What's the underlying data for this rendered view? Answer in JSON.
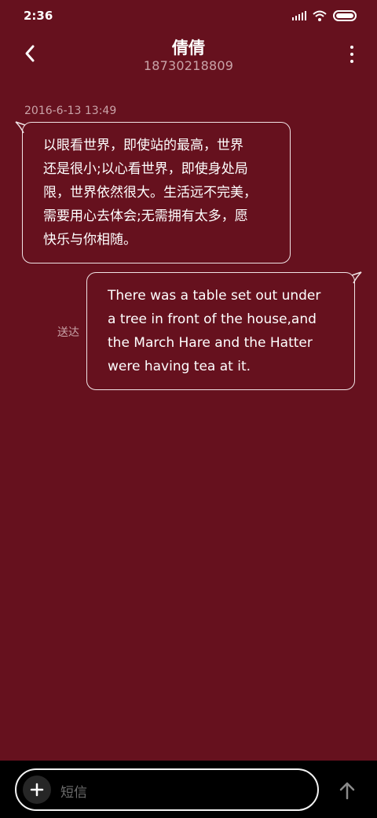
{
  "status_bar": {
    "time": "2:36",
    "icons": [
      "signal-icon",
      "wifi-icon",
      "battery-icon"
    ],
    "battery_level": 1.0
  },
  "header": {
    "contact_name": "倩倩",
    "phone_number": "18730218809",
    "back_icon": "chevron-left-icon",
    "menu_icon": "more-vertical-icon"
  },
  "conversation": {
    "timestamp": "2016-6-13 13:49",
    "messages": [
      {
        "direction": "incoming",
        "text": "以眼看世界，即使站的最高，世界\n还是很小;以心看世界，即使身处局\n限，世界依然很大。生活远不完美，\n需要用心去体会;无需拥有太多，愿\n快乐与你相随。"
      },
      {
        "direction": "outgoing",
        "text": "There was a table set out under\na tree in front of the house,and\nthe March Hare and the Hatter\nwere having tea at it.",
        "status": "送达"
      }
    ]
  },
  "composer": {
    "placeholder": "短信",
    "add_icon": "plus-icon",
    "send_icon": "arrow-up-icon"
  },
  "colors": {
    "background": "#66111e",
    "bubble_border": "#f0e3e5",
    "secondary_text": "#c9a3a8",
    "composer_bg": "#000000"
  }
}
